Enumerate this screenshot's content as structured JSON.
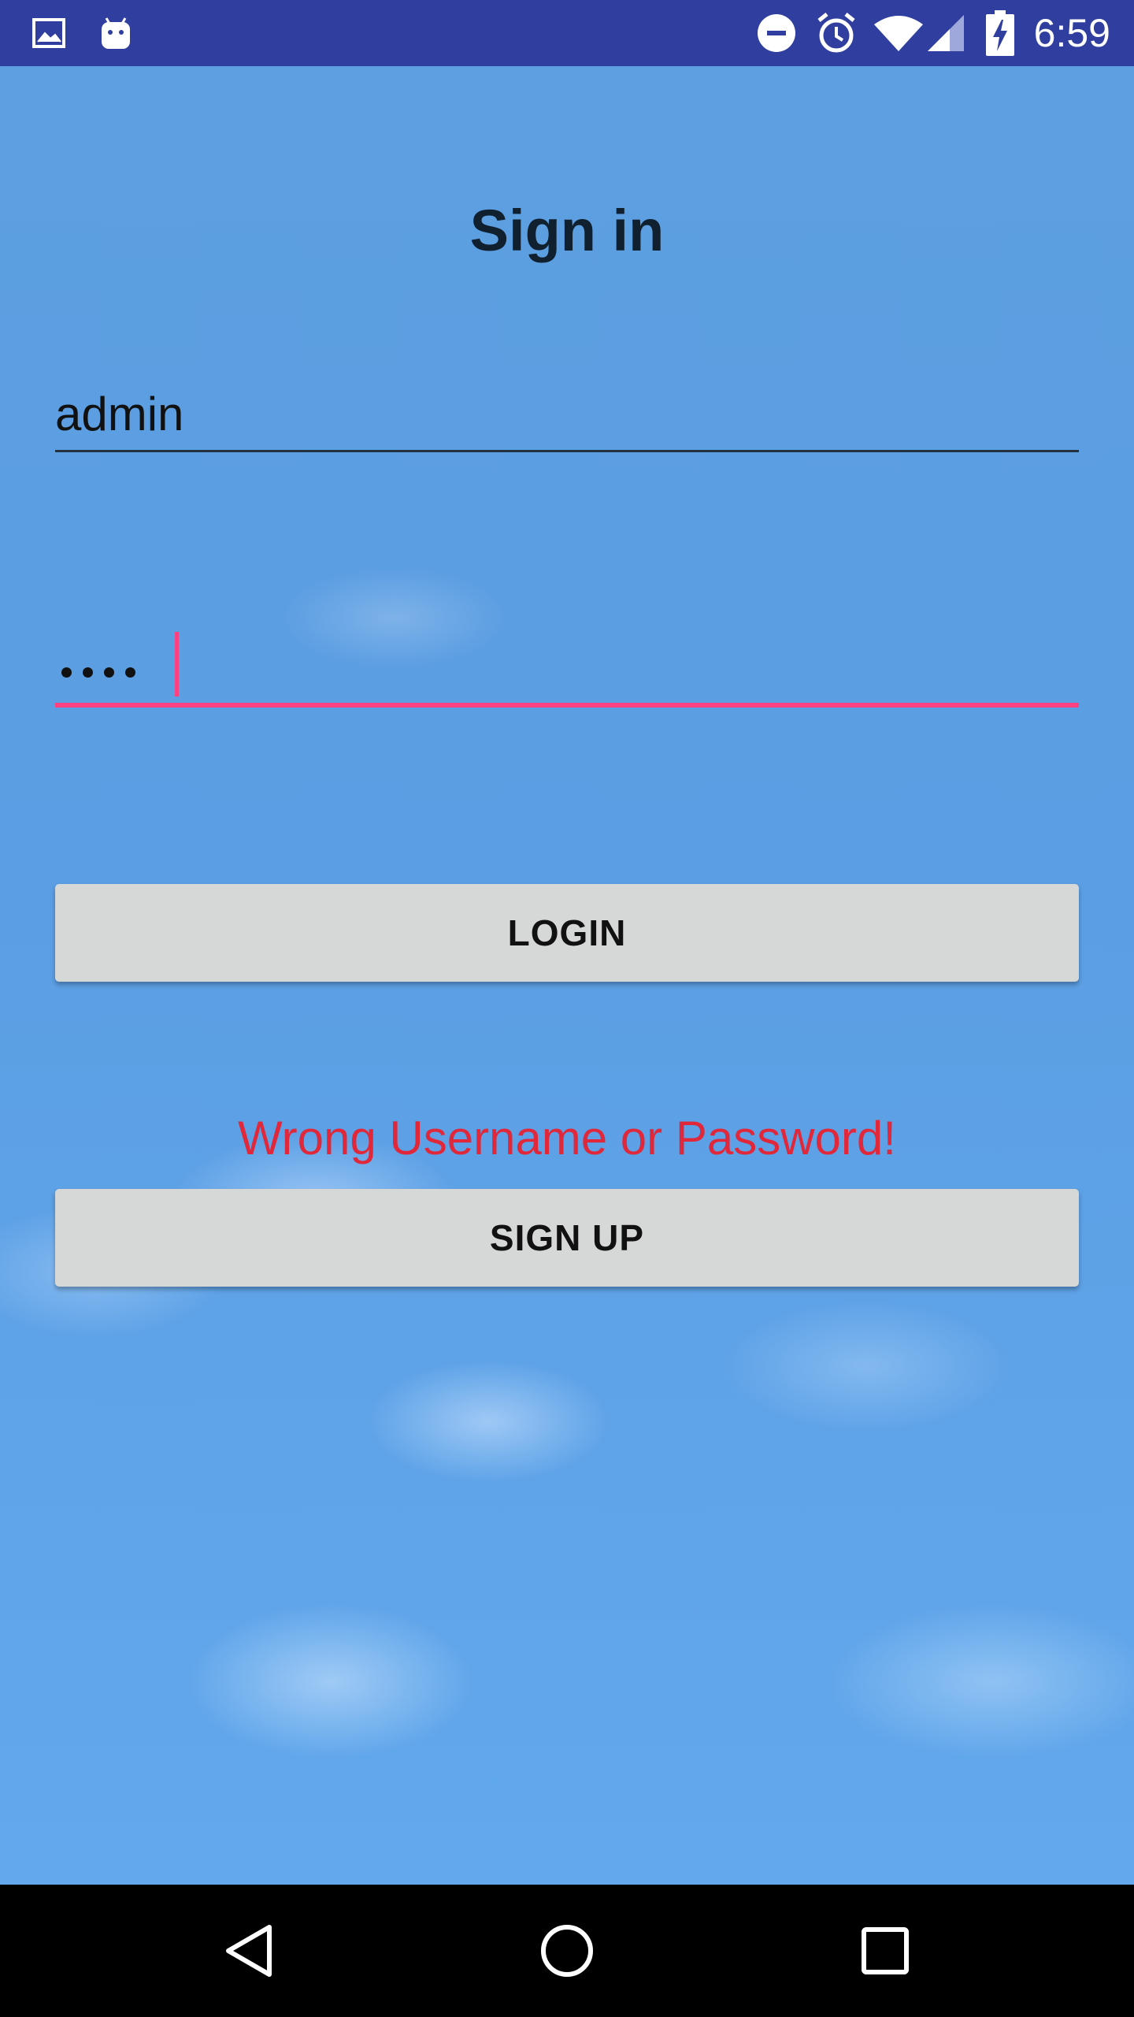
{
  "status_bar": {
    "clock": "6:59",
    "left_icons": [
      "image-icon",
      "android-icon"
    ],
    "right_icons": [
      "do-not-disturb-icon",
      "alarm-icon",
      "wifi-icon",
      "cell-signal-icon",
      "battery-charging-icon"
    ],
    "background_color": "#303f9f"
  },
  "screen": {
    "title": "Sign in"
  },
  "username": {
    "value": "admin"
  },
  "password": {
    "masked_length": 4,
    "accent_color": "#ff4081"
  },
  "login_button": {
    "label": "LOGIN"
  },
  "error": {
    "message": "Wrong Username or Password!",
    "color": "#e0283a"
  },
  "signup_button": {
    "label": "SIGN UP"
  },
  "nav_bar": {
    "buttons": [
      "back-icon",
      "home-icon",
      "recents-icon"
    ]
  }
}
